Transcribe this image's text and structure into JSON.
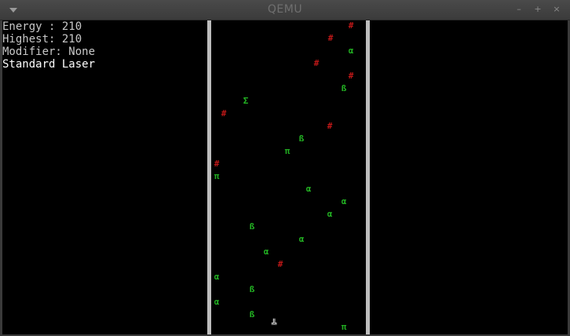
{
  "window": {
    "title": "QEMU",
    "menu_icon": "chevron-down-icon",
    "buttons": [
      "minimize-icon",
      "maximize-icon",
      "close-icon"
    ]
  },
  "hud": {
    "energy": "Energy : 210",
    "highest": "Highest: 210",
    "modifier": "Modifier: None",
    "weapon": "Standard Laser"
  },
  "colors": {
    "green": "#22b022",
    "red": "#c01818",
    "wall": "#bdbdbd",
    "player": "#ffffff"
  },
  "playfield": {
    "objects": [
      {
        "glyph": "#",
        "color": "red"
      },
      {
        "glyph": "#",
        "color": "red"
      },
      {
        "glyph": "α",
        "color": "green"
      },
      {
        "glyph": "#",
        "color": "red"
      },
      {
        "glyph": "#",
        "color": "red"
      },
      {
        "glyph": "ß",
        "color": "green"
      },
      {
        "glyph": "Σ",
        "color": "green"
      },
      {
        "glyph": "#",
        "color": "red"
      },
      {
        "glyph": "#",
        "color": "red"
      },
      {
        "glyph": "ß",
        "color": "green"
      },
      {
        "glyph": "π",
        "color": "green"
      },
      {
        "glyph": "#",
        "color": "red"
      },
      {
        "glyph": "π",
        "color": "green"
      },
      {
        "glyph": "α",
        "color": "green"
      },
      {
        "glyph": "α",
        "color": "green"
      },
      {
        "glyph": "α",
        "color": "green"
      },
      {
        "glyph": "ß",
        "color": "green"
      },
      {
        "glyph": "α",
        "color": "green"
      },
      {
        "glyph": "α",
        "color": "green"
      },
      {
        "glyph": "#",
        "color": "red"
      },
      {
        "glyph": "α",
        "color": "green"
      },
      {
        "glyph": "ß",
        "color": "green"
      },
      {
        "glyph": "α",
        "color": "green"
      },
      {
        "glyph": "ß",
        "color": "green"
      },
      {
        "glyph": "π",
        "color": "green"
      }
    ],
    "player": {
      "glyph": "╩"
    }
  }
}
